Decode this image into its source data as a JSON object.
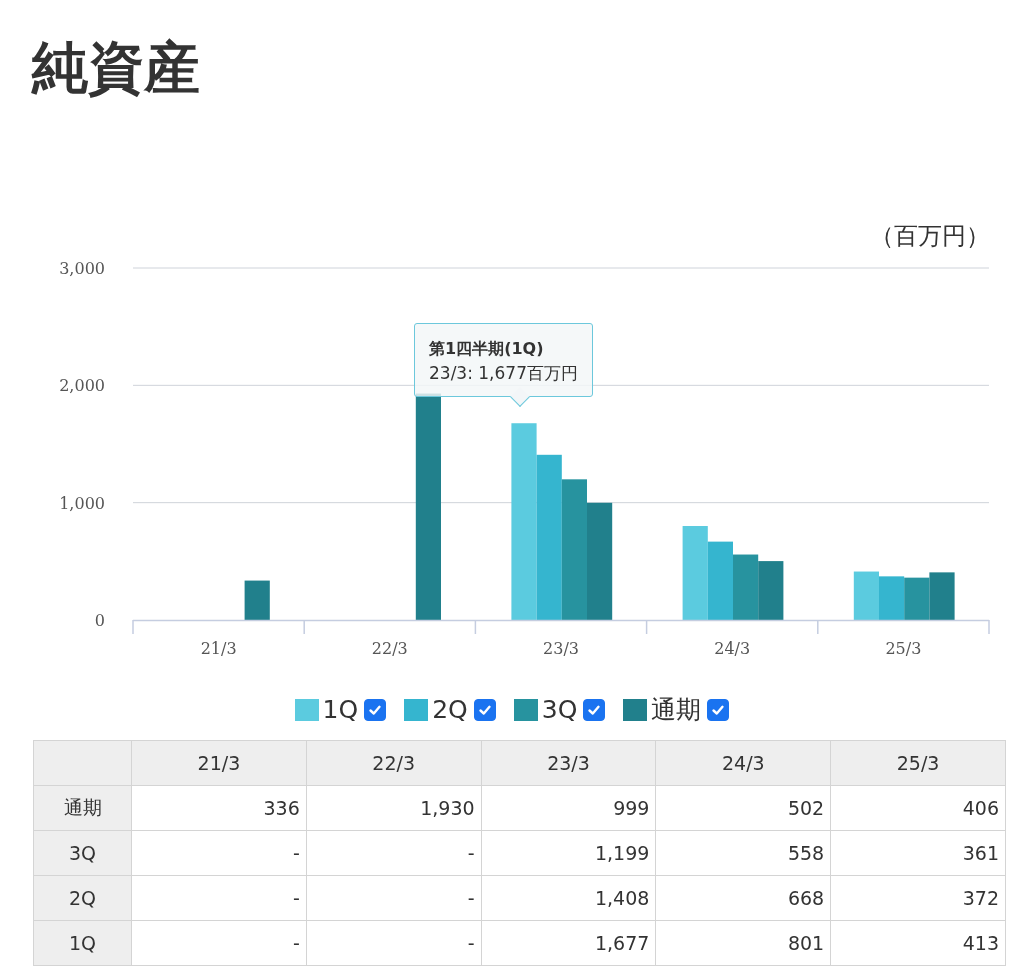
{
  "title": "純資産",
  "chart": {
    "unit": "（百万円）",
    "chart_data": {
      "type": "bar",
      "categories": [
        "21/3",
        "22/3",
        "23/3",
        "24/3",
        "25/3"
      ],
      "ylim": [
        0,
        3000
      ],
      "yticks": [
        {
          "value": 0,
          "label": "0"
        },
        {
          "value": 1000,
          "label": "1,000"
        },
        {
          "value": 2000,
          "label": "2,000"
        },
        {
          "value": 3000,
          "label": "3,000"
        }
      ],
      "series": [
        {
          "name": "1Q",
          "color": "#5bcbdf",
          "values": [
            null,
            null,
            1677,
            801,
            413
          ]
        },
        {
          "name": "2Q",
          "color": "#35b5cf",
          "values": [
            null,
            null,
            1408,
            668,
            372
          ]
        },
        {
          "name": "3Q",
          "color": "#27939f",
          "values": [
            null,
            null,
            1199,
            558,
            361
          ]
        },
        {
          "name": "通期",
          "color": "#21808c",
          "values": [
            336,
            1930,
            999,
            502,
            406
          ]
        }
      ]
    },
    "legend": [
      {
        "checked": true
      },
      {
        "checked": true
      },
      {
        "checked": true
      },
      {
        "checked": true
      }
    ],
    "tooltip": {
      "title": "第1四半期(1Q)",
      "text": "23/3: 1,677百万円"
    }
  },
  "table": {
    "columns": [
      "21/3",
      "22/3",
      "23/3",
      "24/3",
      "25/3"
    ],
    "rows": [
      {
        "label": "通期",
        "cells": [
          "336",
          "1,930",
          "999",
          "502",
          "406"
        ]
      },
      {
        "label": "3Q",
        "cells": [
          "-",
          "-",
          "1,199",
          "558",
          "361"
        ]
      },
      {
        "label": "2Q",
        "cells": [
          "-",
          "-",
          "1,408",
          "668",
          "372"
        ]
      },
      {
        "label": "1Q",
        "cells": [
          "-",
          "-",
          "1,677",
          "801",
          "413"
        ]
      }
    ]
  }
}
